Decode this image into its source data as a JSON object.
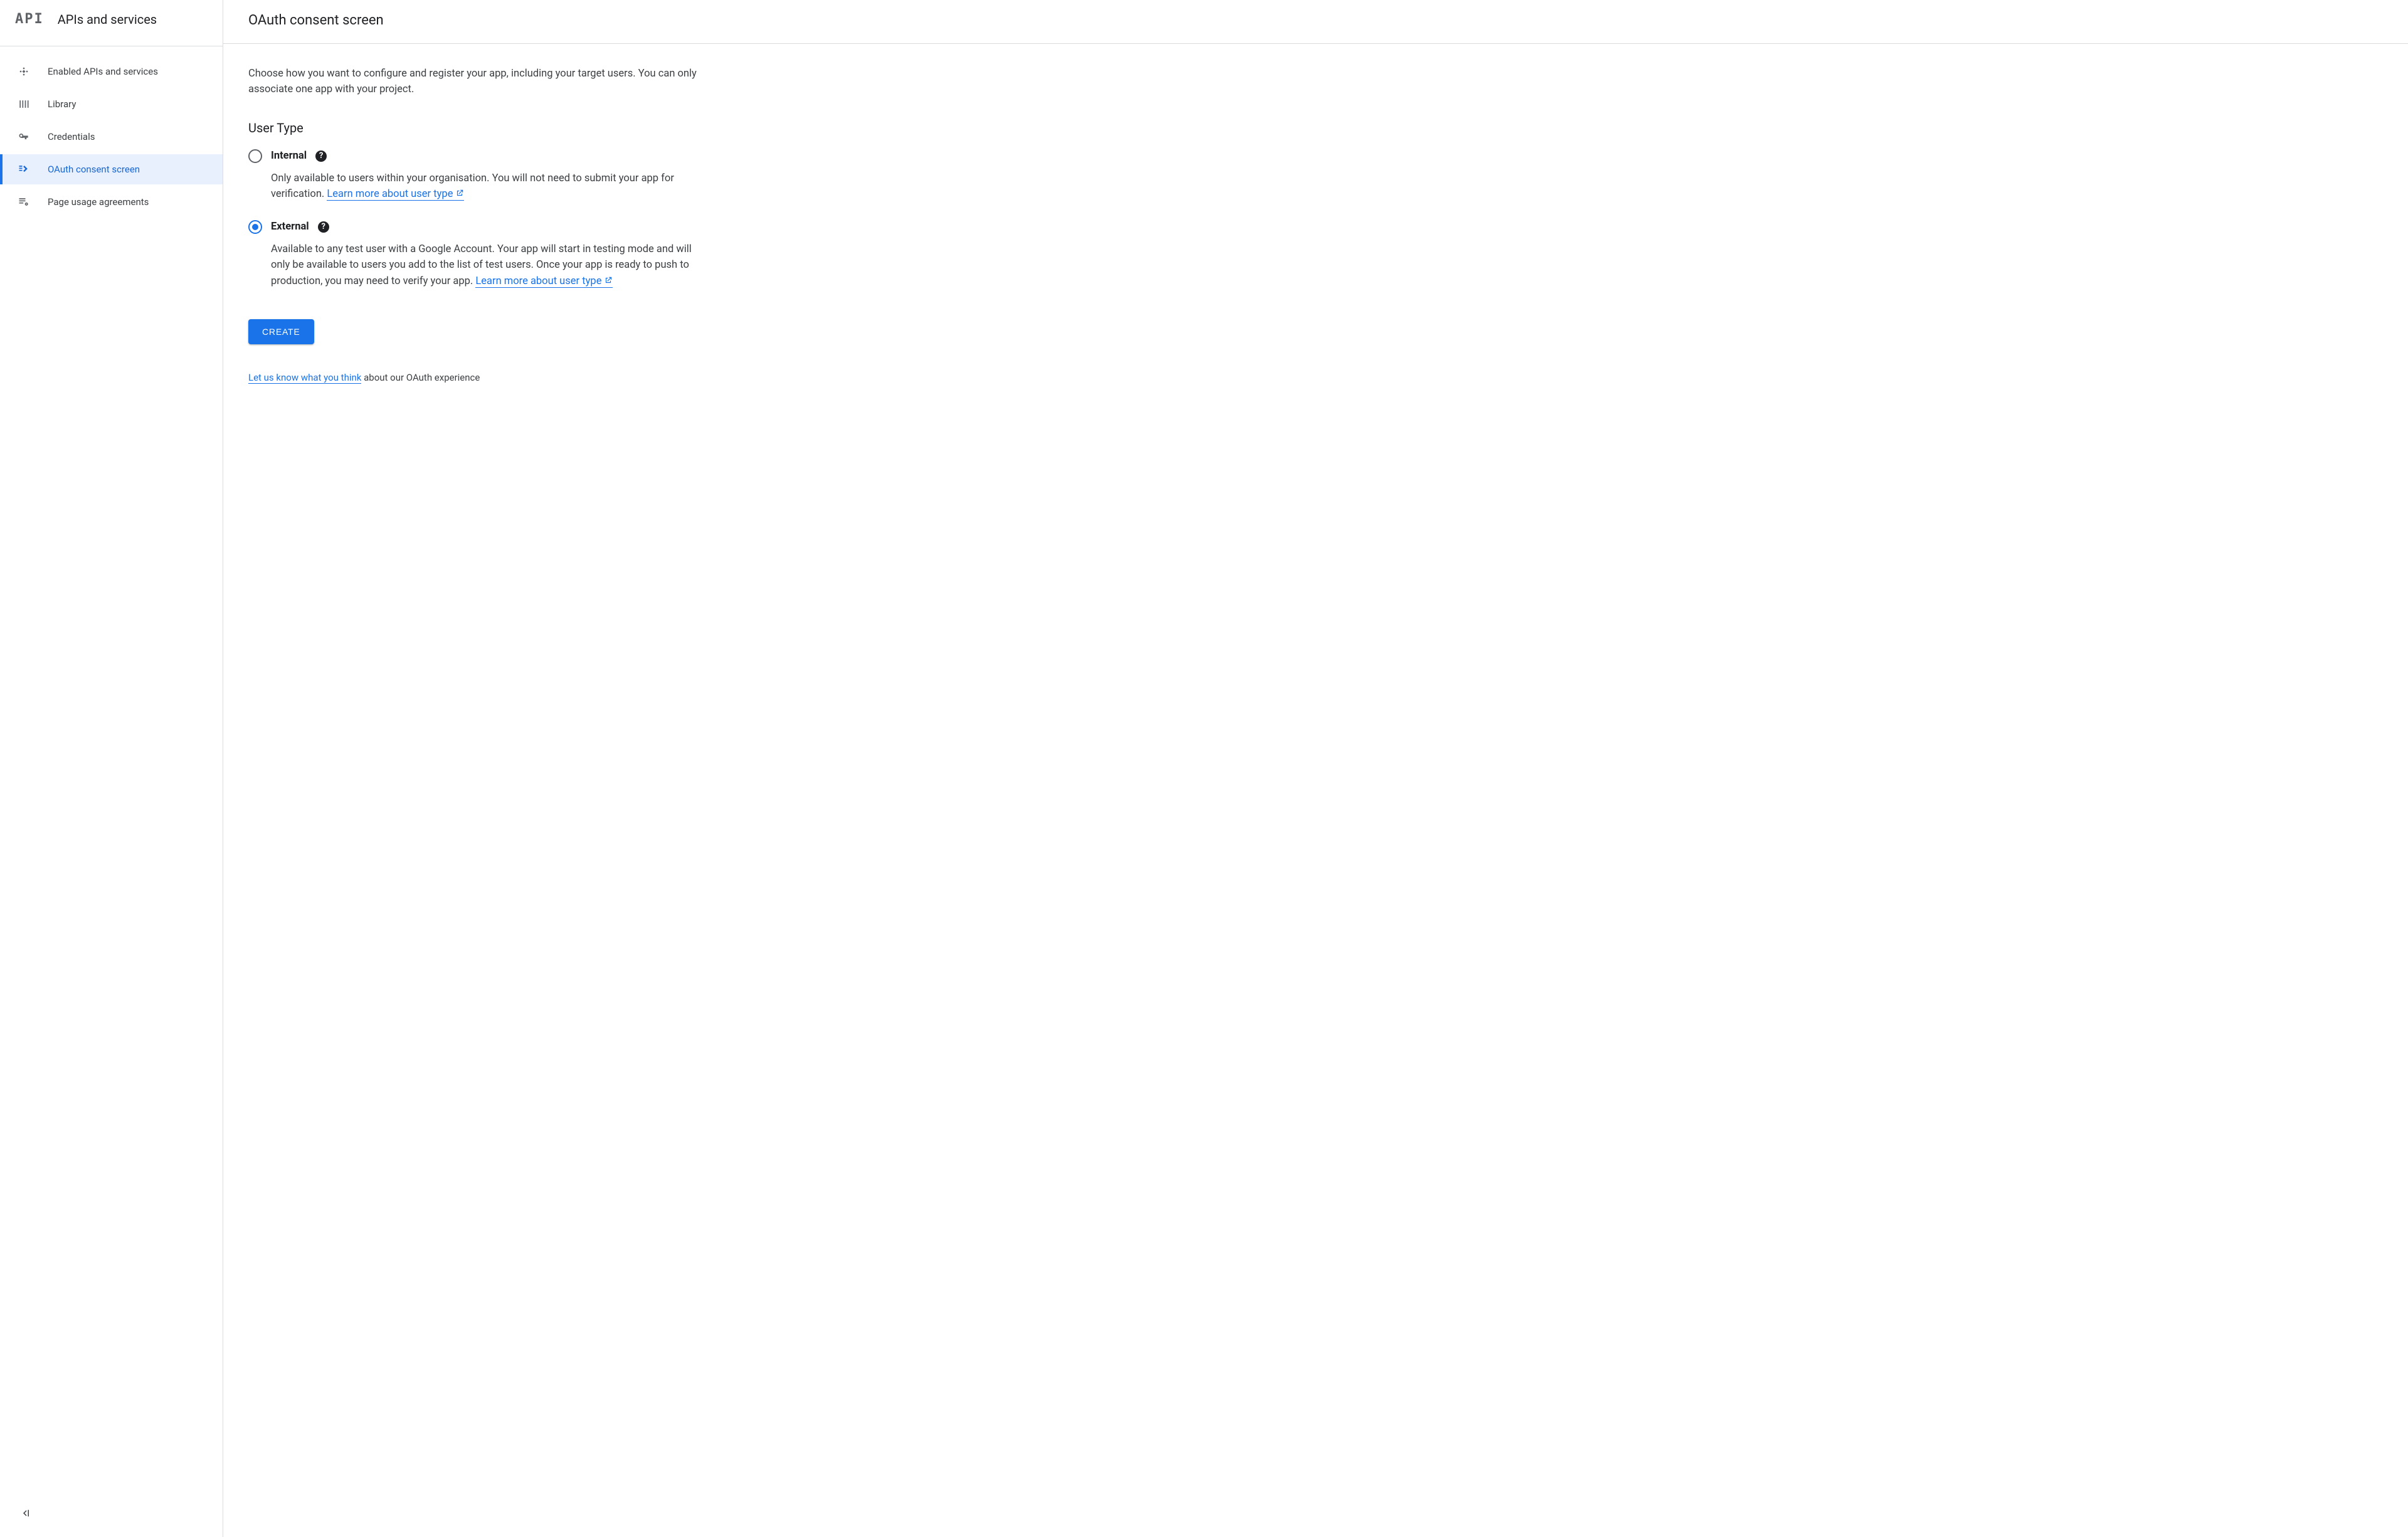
{
  "sidebar": {
    "logo": "API",
    "title": "APIs and services",
    "items": [
      {
        "label": "Enabled APIs and services"
      },
      {
        "label": "Library"
      },
      {
        "label": "Credentials"
      },
      {
        "label": "OAuth consent screen"
      },
      {
        "label": "Page usage agreements"
      }
    ],
    "active_index": 3
  },
  "page": {
    "title": "OAuth consent screen",
    "intro": "Choose how you want to configure and register your app, including your target users. You can only associate one app with your project.",
    "section_title": "User Type",
    "options": {
      "internal": {
        "label": "Internal",
        "desc_pre": "Only available to users within your organisation. You will not need to submit your app for verification. ",
        "link_text": "Learn more about user type"
      },
      "external": {
        "label": "External",
        "desc_pre": "Available to any test user with a Google Account. Your app will start in testing mode and will only be available to users you add to the list of test users. Once your app is ready to push to production, you may need to verify your app. ",
        "link_text": "Learn more about user type"
      }
    },
    "selected_option": "external",
    "create_button": "CREATE",
    "feedback_link": "Let us know what you think",
    "feedback_suffix": " about our OAuth experience"
  }
}
